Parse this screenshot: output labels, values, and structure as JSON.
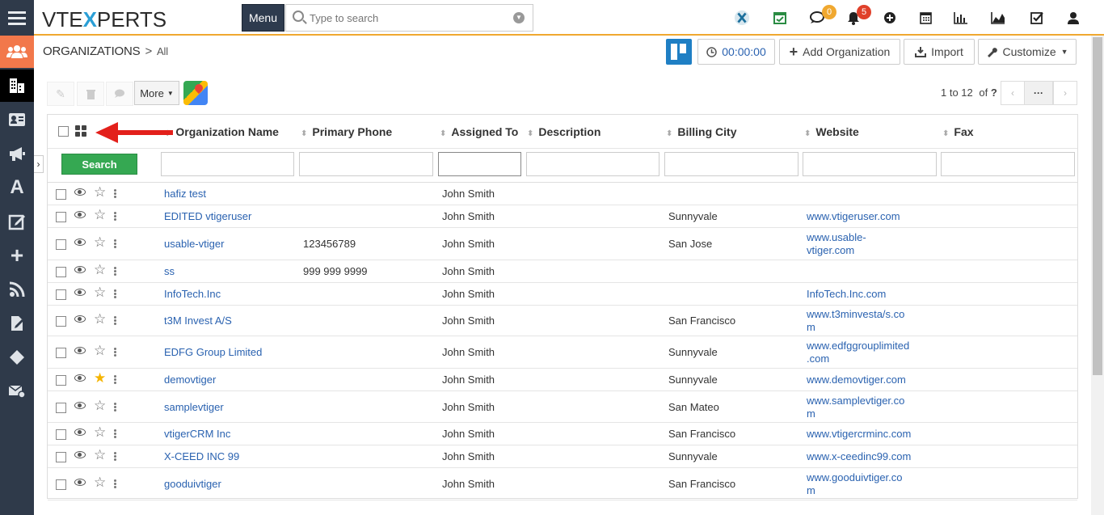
{
  "header": {
    "logo_left": "VTE",
    "logo_x": "X",
    "logo_right": "PERTS",
    "menu_label": "Menu",
    "search_placeholder": "Type to search",
    "chat_badge": "0",
    "notif_badge": "5",
    "accent_orange": "#f0a830"
  },
  "sidebar": {
    "items": [
      {
        "name": "hamburger-menu-icon"
      },
      {
        "name": "contacts-icon"
      },
      {
        "name": "organizations-icon"
      },
      {
        "name": "id-card-icon"
      },
      {
        "name": "megaphone-icon"
      },
      {
        "name": "font-icon"
      },
      {
        "name": "edit-icon"
      },
      {
        "name": "plus-icon"
      },
      {
        "name": "rss-icon"
      },
      {
        "name": "documents-icon"
      },
      {
        "name": "diamond-icon"
      },
      {
        "name": "mail-settings-icon"
      }
    ]
  },
  "breadcrumb": {
    "module": "ORGANIZATIONS",
    "separator": ">",
    "view": "All"
  },
  "actions": {
    "timer": "00:00:00",
    "add": "Add Organization",
    "import": "Import",
    "customize": "Customize"
  },
  "toolbar": {
    "more": "More",
    "pager_range": "1 to 12",
    "pager_of": "of",
    "pager_total": "?",
    "pager_more": "···"
  },
  "table": {
    "search_button": "Search",
    "columns": [
      "Organization Name",
      "Primary Phone",
      "Assigned To",
      "Description",
      "Billing City",
      "Website",
      "Fax"
    ],
    "rows": [
      {
        "name": "hafiz test",
        "phone": "",
        "assigned": "John Smith",
        "city": "",
        "web1": "",
        "web2": "",
        "starred": false
      },
      {
        "name": "EDITED vtigeruser",
        "phone": "",
        "assigned": "John Smith",
        "city": "Sunnyvale",
        "web1": "www.vtigeruser.com",
        "web2": "",
        "starred": false
      },
      {
        "name": "usable-vtiger",
        "phone": "123456789",
        "assigned": "John Smith",
        "city": "San Jose",
        "web1": "www.usable-",
        "web2": "vtiger.com",
        "starred": false
      },
      {
        "name": "ss",
        "phone": "999 999 9999",
        "assigned": "John Smith",
        "city": "",
        "web1": "",
        "web2": "",
        "starred": false
      },
      {
        "name": "InfoTech.Inc",
        "phone": "",
        "assigned": "John Smith",
        "city": "",
        "web1": "InfoTech.Inc.com",
        "web2": "",
        "starred": false
      },
      {
        "name": "t3M Invest A/S",
        "phone": "",
        "assigned": "John Smith",
        "city": "San Francisco",
        "web1": "www.t3minvesta/s.co",
        "web2": "m",
        "starred": false
      },
      {
        "name": "EDFG Group Limited",
        "phone": "",
        "assigned": "John Smith",
        "city": "Sunnyvale",
        "web1": "www.edfggrouplimited",
        "web2": ".com",
        "starred": false
      },
      {
        "name": "demovtiger",
        "phone": "",
        "assigned": "John Smith",
        "city": "Sunnyvale",
        "web1": "www.demovtiger.com",
        "web2": "",
        "starred": true
      },
      {
        "name": "samplevtiger",
        "phone": "",
        "assigned": "John Smith",
        "city": "San Mateo",
        "web1": "www.samplevtiger.co",
        "web2": "m",
        "starred": false
      },
      {
        "name": "vtigerCRM Inc",
        "phone": "",
        "assigned": "John Smith",
        "city": "San Francisco",
        "web1": "www.vtigercrminc.com",
        "web2": "",
        "starred": false
      },
      {
        "name": "X-CEED INC 99",
        "phone": "",
        "assigned": "John Smith",
        "city": "Sunnyvale",
        "web1": "www.x-ceedinc99.com",
        "web2": "",
        "starred": false
      },
      {
        "name": "gooduivtiger",
        "phone": "",
        "assigned": "John Smith",
        "city": "San Francisco",
        "web1": "www.gooduivtiger.co",
        "web2": "m",
        "starred": false
      }
    ]
  }
}
